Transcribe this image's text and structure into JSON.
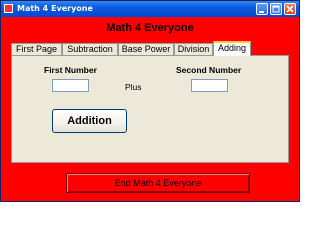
{
  "window": {
    "title": "Math 4 Everyone",
    "background_color": "#ff0000",
    "titlebar_color": "#0a5ee0",
    "controls": {
      "minimize_icon": "minimize-icon",
      "maximize_icon": "maximize-icon",
      "close_icon": "close-icon"
    }
  },
  "heading": "Math 4 Everyone",
  "tabs": [
    {
      "label": "First Page",
      "selected": false
    },
    {
      "label": "Subtraction",
      "selected": false
    },
    {
      "label": "Base Power",
      "selected": false
    },
    {
      "label": "Division",
      "selected": false
    },
    {
      "label": "Adding",
      "selected": true
    }
  ],
  "adding_panel": {
    "first_label": "First Number",
    "second_label": "Second Number",
    "operator_label": "Plus",
    "first_value": "",
    "second_value": "",
    "button_label": "Addition"
  },
  "footer": {
    "end_label": "End Math 4 Everyone"
  }
}
